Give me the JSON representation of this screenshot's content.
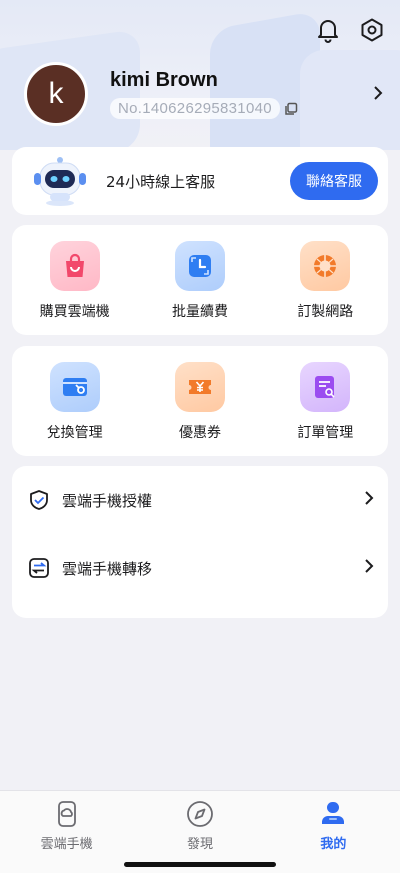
{
  "header": {
    "icons": [
      "bell-icon",
      "settings-hexagon-icon"
    ]
  },
  "profile": {
    "avatar_letter": "k",
    "name": "kimi Brown",
    "user_id": "No.140626295831040"
  },
  "support": {
    "text": "24小時線上客服",
    "button_label": "聯絡客服"
  },
  "grid1": {
    "items": [
      {
        "label": "購買雲端機",
        "icon": "shopping-bag-icon",
        "color": "#f2486b"
      },
      {
        "label": "批量續費",
        "icon": "renew-clock-icon",
        "color": "#2f7ef2"
      },
      {
        "label": "訂製網路",
        "icon": "network-globe-icon",
        "color": "#f27a2a"
      }
    ]
  },
  "grid2": {
    "items": [
      {
        "label": "兌換管理",
        "icon": "redeem-card-icon",
        "color": "#2f7ef2"
      },
      {
        "label": "優惠券",
        "icon": "coupon-icon",
        "color": "#f27a2a"
      },
      {
        "label": "訂單管理",
        "icon": "order-search-icon",
        "color": "#9b4cf0"
      }
    ]
  },
  "menu": {
    "items": [
      {
        "label": "雲端手機授權",
        "icon": "shield-check-icon"
      },
      {
        "label": "雲端手機轉移",
        "icon": "transfer-icon"
      }
    ]
  },
  "tabbar": {
    "tabs": [
      {
        "label": "雲端手機",
        "icon": "cloud-phone-icon",
        "active": false
      },
      {
        "label": "發現",
        "icon": "compass-icon",
        "active": false
      },
      {
        "label": "我的",
        "icon": "profile-icon",
        "active": true
      }
    ]
  },
  "colors": {
    "accent": "#2f6bf0",
    "background": "#f1f1f6",
    "avatar": "#5a2f24"
  }
}
